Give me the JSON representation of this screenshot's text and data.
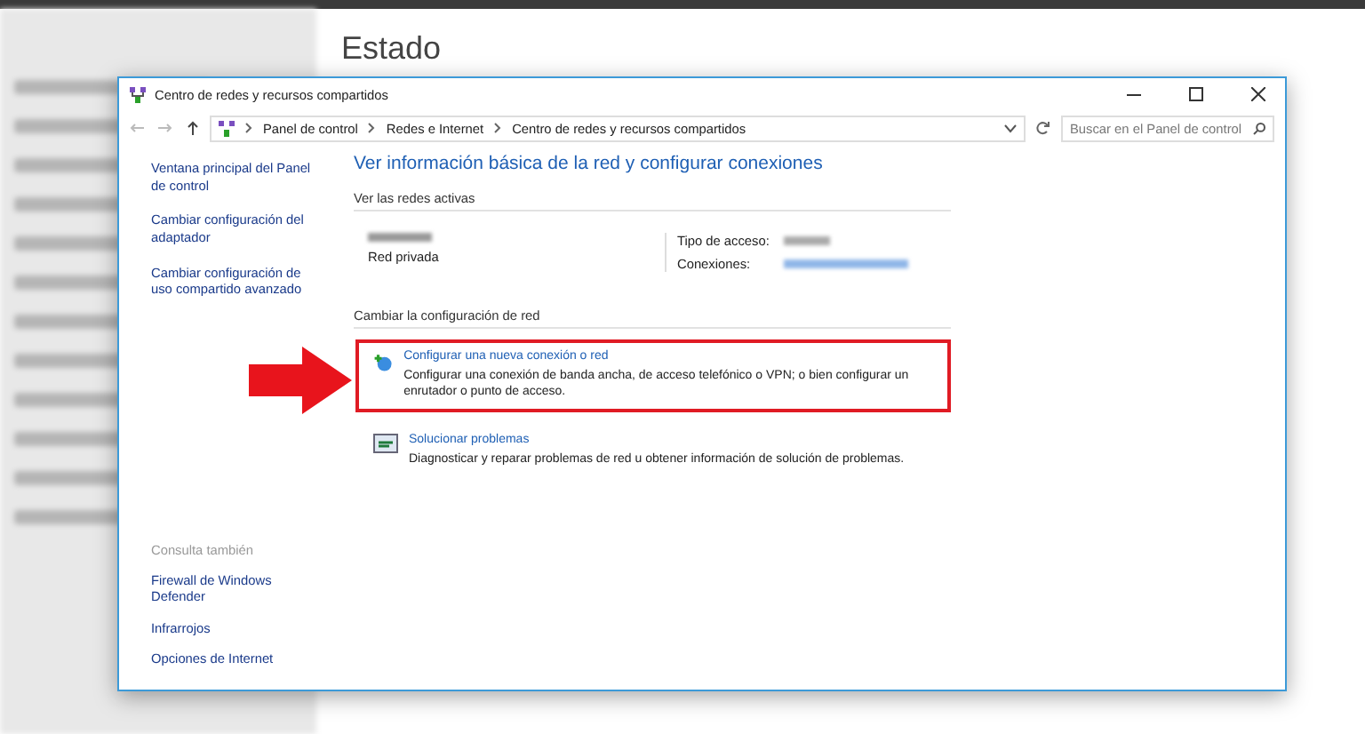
{
  "background": {
    "heading": "Estado"
  },
  "window": {
    "title": "Centro de redes y recursos compartidos",
    "breadcrumbs": [
      "Panel de control",
      "Redes e Internet",
      "Centro de redes y recursos compartidos"
    ],
    "search": {
      "placeholder": "Buscar en el Panel de control"
    }
  },
  "sidebar": {
    "links": [
      "Ventana principal del Panel de control",
      "Cambiar configuración del adaptador",
      "Cambiar configuración de uso compartido avanzado"
    ],
    "see_also_heading": "Consulta también",
    "see_also": [
      "Firewall de Windows Defender",
      "Infrarrojos",
      "Opciones de Internet"
    ]
  },
  "main": {
    "heading": "Ver información básica de la red y configurar conexiones",
    "active_networks_label": "Ver las redes activas",
    "network": {
      "type": "Red privada",
      "access_label": "Tipo de acceso:",
      "connections_label": "Conexiones:"
    },
    "change_label": "Cambiar la configuración de red",
    "tasks": [
      {
        "kind": "new-connection",
        "title": "Configurar una nueva conexión o red",
        "description": "Configurar una conexión de banda ancha, de acceso telefónico o VPN; o bien configurar un enrutador o punto de acceso.",
        "highlighted": true
      },
      {
        "kind": "troubleshoot",
        "title": "Solucionar problemas",
        "description": "Diagnosticar y reparar problemas de red u obtener información de solución de problemas.",
        "highlighted": false
      }
    ]
  }
}
